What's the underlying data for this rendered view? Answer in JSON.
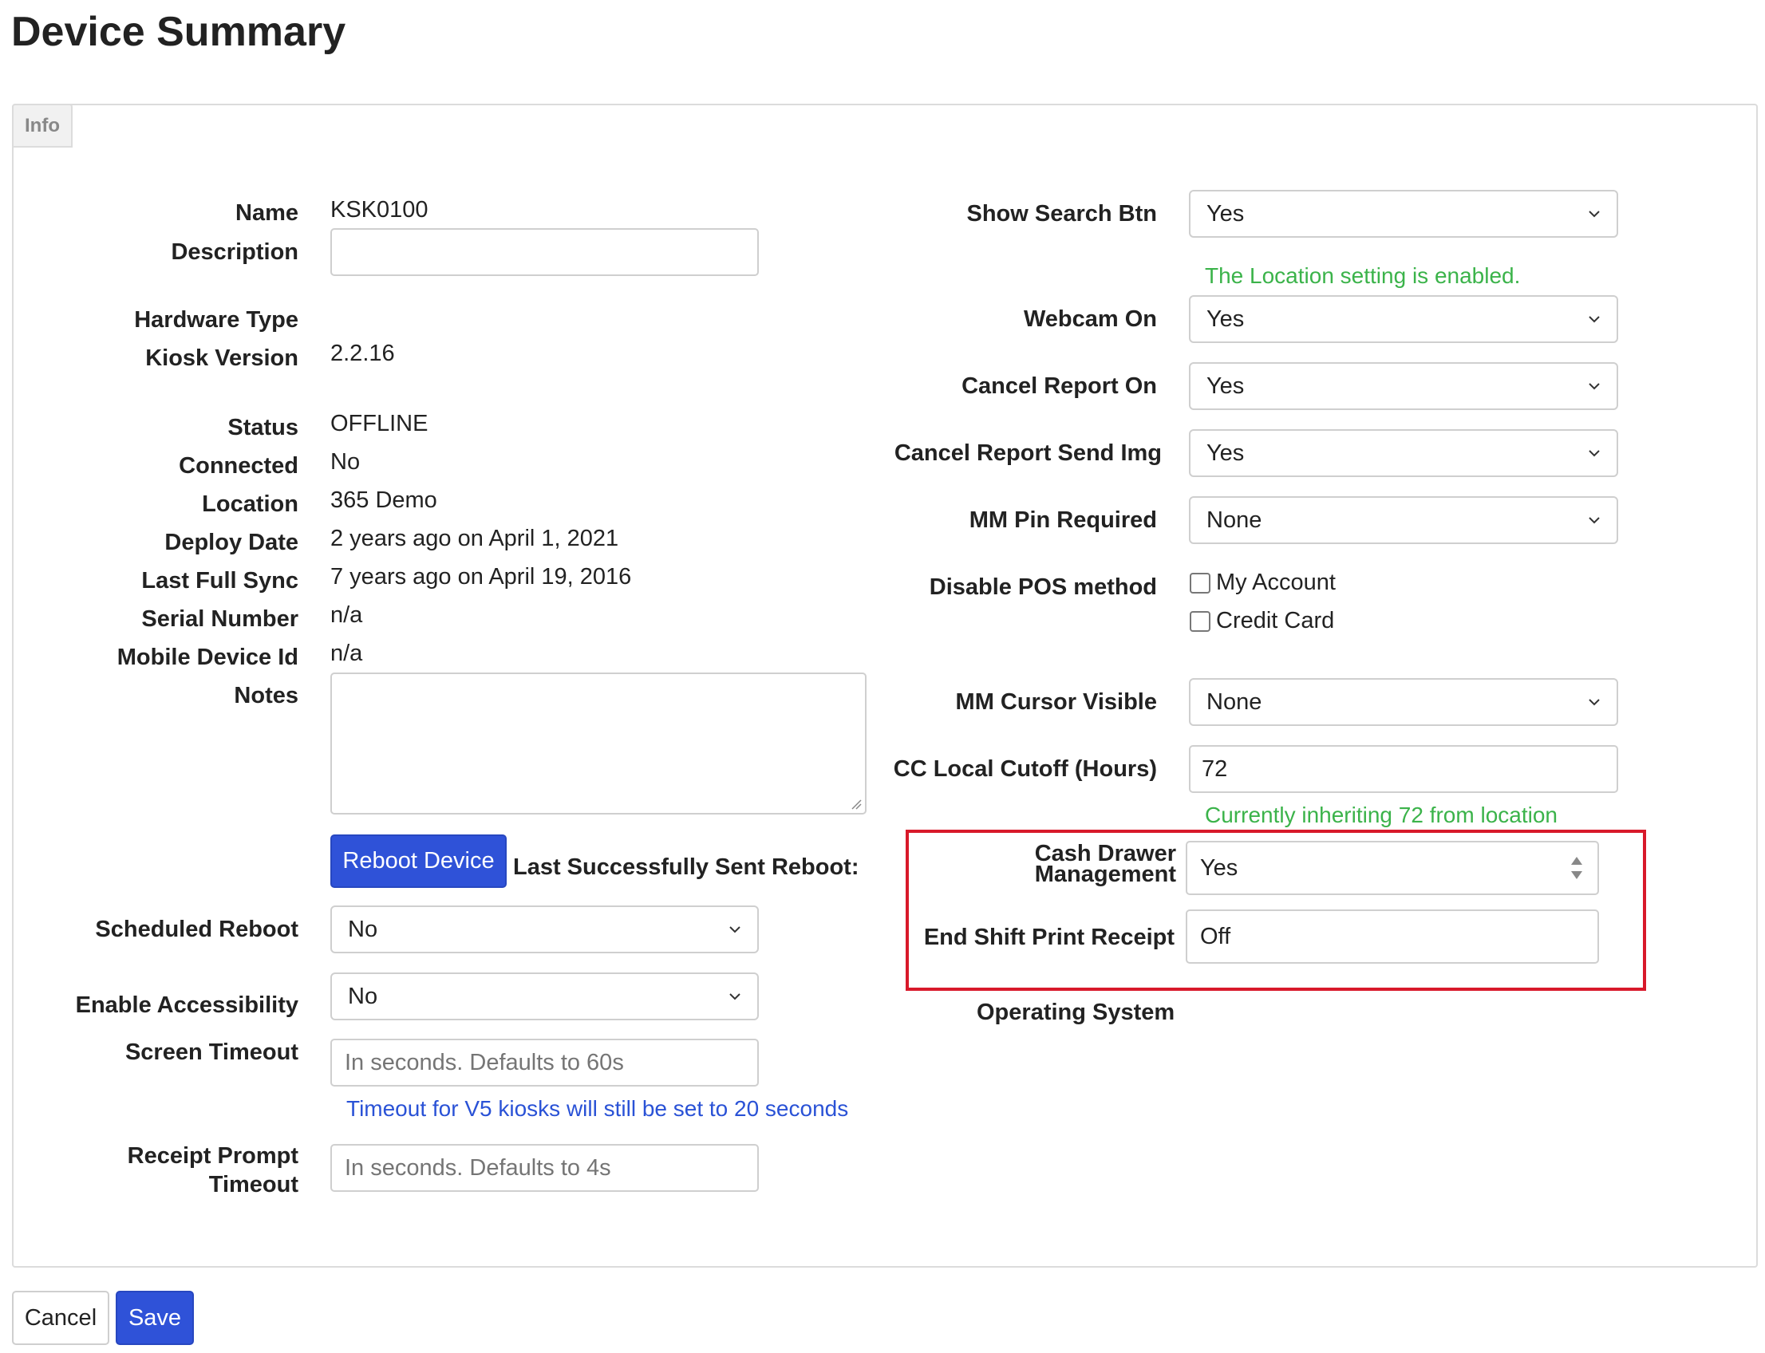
{
  "page": {
    "title": "Device Summary"
  },
  "tabs": [
    {
      "label": "Info"
    }
  ],
  "left": {
    "name": {
      "label": "Name",
      "value": "KSK0100"
    },
    "description": {
      "label": "Description",
      "value": ""
    },
    "hardware_type": {
      "label": "Hardware Type",
      "value": ""
    },
    "kiosk_version": {
      "label": "Kiosk Version",
      "value": "2.2.16"
    },
    "status": {
      "label": "Status",
      "value": "OFFLINE"
    },
    "connected": {
      "label": "Connected",
      "value": "No"
    },
    "location": {
      "label": "Location",
      "value": "365 Demo"
    },
    "deploy_date": {
      "label": "Deploy Date",
      "value": "2 years ago on April 1, 2021"
    },
    "last_full_sync": {
      "label": "Last Full Sync",
      "value": "7 years ago on April 19, 2016"
    },
    "serial_number": {
      "label": "Serial Number",
      "value": "n/a"
    },
    "mobile_device_id": {
      "label": "Mobile Device Id",
      "value": "n/a"
    },
    "notes": {
      "label": "Notes",
      "value": ""
    },
    "reboot": {
      "button_label": "Reboot Device",
      "last_sent_label": "Last Successfully Sent Reboot:"
    },
    "scheduled_reboot": {
      "label": "Scheduled Reboot",
      "value": "No"
    },
    "enable_accessibility": {
      "label": "Enable Accessibility",
      "value": "No"
    },
    "screen_timeout": {
      "label": "Screen Timeout",
      "placeholder": "In seconds. Defaults to 60s",
      "help": "Timeout for V5 kiosks will still be set to 20 seconds"
    },
    "receipt_prompt_timeout": {
      "label_line1": "Receipt Prompt",
      "label_line2": "Timeout",
      "placeholder": "In seconds. Defaults to 4s"
    }
  },
  "right": {
    "show_search_btn": {
      "label": "Show Search Btn",
      "value": "Yes",
      "help": "The Location setting is enabled."
    },
    "webcam_on": {
      "label": "Webcam On",
      "value": "Yes"
    },
    "cancel_report_on": {
      "label": "Cancel Report On",
      "value": "Yes"
    },
    "cancel_report_send_img": {
      "label": "Cancel Report Send Img",
      "value": "Yes"
    },
    "mm_pin_required": {
      "label": "MM Pin Required",
      "value": "None"
    },
    "disable_pos_method": {
      "label": "Disable POS method",
      "options": [
        {
          "label": "My Account",
          "checked": false
        },
        {
          "label": "Credit Card",
          "checked": false
        }
      ]
    },
    "mm_cursor_visible": {
      "label": "MM Cursor Visible",
      "value": "None"
    },
    "cc_local_cutoff": {
      "label": "CC Local Cutoff (Hours)",
      "value": "72",
      "help": "Currently inheriting 72 from location"
    },
    "cash_drawer_management": {
      "label_line1": "Cash Drawer",
      "label_line2": "Management",
      "value": "Yes"
    },
    "end_shift_print_receipt": {
      "label": "End Shift Print Receipt",
      "value": "Off"
    },
    "operating_system": {
      "label": "Operating System"
    }
  },
  "footer": {
    "cancel_label": "Cancel",
    "save_label": "Save"
  },
  "colors": {
    "primary": "#2f52d8",
    "success_text": "#3bb34a",
    "info_text": "#2a52d6",
    "highlight_border": "#d8192a"
  },
  "icons": {
    "select_arrow": "chevron-down-icon",
    "spinner": "up-down-arrows-icon",
    "checkbox": "checkbox-icon"
  }
}
